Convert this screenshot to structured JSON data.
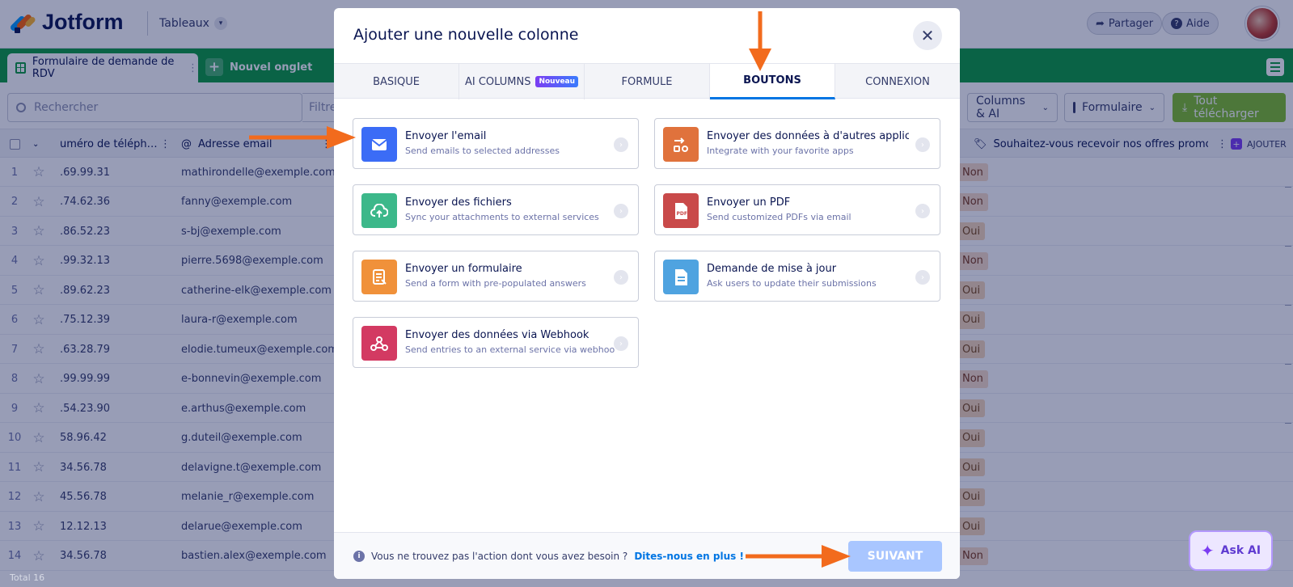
{
  "topbar": {
    "logo_text": "Jotform",
    "tableaux_label": "Tableaux",
    "share_label": "Partager",
    "help_label": "Aide"
  },
  "tabs": {
    "active_label": "Formulaire de demande de RDV",
    "new_tab_label": "Nouvel onglet"
  },
  "toolbar": {
    "search_placeholder": "Rechercher",
    "filter_label": "Filtre",
    "columns_ai_label": "Columns & AI",
    "form_label": "Formulaire",
    "download_label": "Tout télécharger"
  },
  "table": {
    "headers": {
      "phone": "uméro de téléph…",
      "email": "Adresse email",
      "promo": "Souhaitez-vous recevoir nos offres promoti…",
      "add": "AJOUTER"
    },
    "rows": [
      {
        "n": "1",
        "phone": ".69.99.31",
        "email": "mathirondelle@exemple.com",
        "opt": "Non"
      },
      {
        "n": "2",
        "phone": ".74.62.36",
        "email": "fanny@exemple.com",
        "opt": "Non"
      },
      {
        "n": "3",
        "phone": ".86.52.23",
        "email": "s-bj@exemple.com",
        "opt": "Oui"
      },
      {
        "n": "4",
        "phone": ".99.32.13",
        "email": "pierre.5698@exemple.com",
        "opt": "Non"
      },
      {
        "n": "5",
        "phone": ".89.62.23",
        "email": "catherine-elk@exemple.com",
        "opt": "Oui"
      },
      {
        "n": "6",
        "phone": ".75.12.39",
        "email": "laura-r@exemple.com",
        "opt": "Oui"
      },
      {
        "n": "7",
        "phone": ".63.28.79",
        "email": "elodie.tumeux@exemple.com",
        "opt": "Oui"
      },
      {
        "n": "8",
        "phone": ".99.99.99",
        "email": "e-bonnevin@exemple.com",
        "opt": "Non"
      },
      {
        "n": "9",
        "phone": ".54.23.90",
        "email": "e.arthus@exemple.com",
        "opt": "Oui"
      },
      {
        "n": "10",
        "phone": "58.96.42",
        "email": "g.duteil@exemple.com",
        "opt": "Oui"
      },
      {
        "n": "11",
        "phone": "34.56.78",
        "email": "delavigne.t@exemple.com",
        "opt": "Oui"
      },
      {
        "n": "12",
        "phone": "45.56.78",
        "email": "melanie_r@exemple.com",
        "opt": "Oui"
      },
      {
        "n": "13",
        "phone": "12.12.13",
        "email": "delarue@exemple.com",
        "opt": "Oui"
      },
      {
        "n": "14",
        "phone": "34.56.78",
        "email": "bastien.alex@exemple.com",
        "opt": "Non"
      }
    ],
    "total_label": "Total 16"
  },
  "ask_ai_label": "Ask AI",
  "modal": {
    "title": "Ajouter une nouvelle colonne",
    "tabs": [
      {
        "label": "BASIQUE"
      },
      {
        "label": "AI COLUMNS",
        "badge": "Nouveau"
      },
      {
        "label": "FORMULE"
      },
      {
        "label": "BOUTONS"
      },
      {
        "label": "CONNEXION"
      }
    ],
    "active_tab": "BOUTONS",
    "cards": [
      {
        "title": "Envoyer l'email",
        "desc": "Send emails to selected addresses",
        "icon": "mail-icon",
        "color": "#3b6cf6"
      },
      {
        "title": "Envoyer des données à d'autres applic…",
        "desc": "Integrate with your favorite apps",
        "icon": "apps-icon",
        "color": "#e0723c"
      },
      {
        "title": "Envoyer des fichiers",
        "desc": "Sync your attachments to external services",
        "icon": "cloud-upload-icon",
        "color": "#3cb88a"
      },
      {
        "title": "Envoyer un PDF",
        "desc": "Send customized PDFs via email",
        "icon": "pdf-icon",
        "color": "#c94a4a"
      },
      {
        "title": "Envoyer un formulaire",
        "desc": "Send a form with pre-populated answers",
        "icon": "form-icon",
        "color": "#f0913a"
      },
      {
        "title": "Demande de mise à jour",
        "desc": "Ask users to update their submissions",
        "icon": "document-icon",
        "color": "#4fa3e0"
      },
      {
        "title": "Envoyer des données via Webhook",
        "desc": "Send entries to an external service via webhook",
        "icon": "webhook-icon",
        "color": "#d33a62"
      }
    ],
    "footer": {
      "info_text": "Vous ne trouvez pas l'action dont vous avez besoin ?",
      "link_text": "Dites-nous en plus !",
      "next_label": "SUIVANT"
    }
  },
  "colors": {
    "green_bar": "#0b9b3f",
    "accent_arrow": "#f26b1d",
    "active_tab_underline": "#0075e3"
  }
}
